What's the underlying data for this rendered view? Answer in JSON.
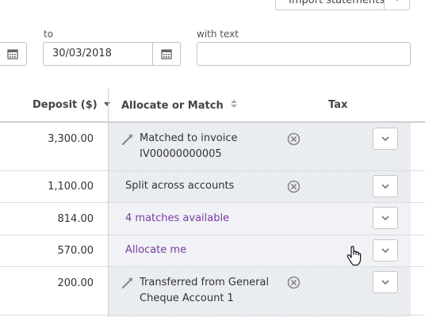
{
  "toolbar": {
    "import_label": "Import statements"
  },
  "filters": {
    "to_label": "to",
    "to_value": "30/03/2018",
    "text_label": "with text",
    "text_value": ""
  },
  "table": {
    "headers": {
      "deposit": "Deposit ($)",
      "allocate": "Allocate or Match",
      "tax": "Tax"
    },
    "rows": [
      {
        "deposit": "3,300.00",
        "line1": "Matched to invoice",
        "line2": "IV00000000005",
        "type": "matched"
      },
      {
        "deposit": "1,100.00",
        "line1": "Split across accounts",
        "line2": "",
        "type": "split"
      },
      {
        "deposit": "814.00",
        "line1": "4 matches available",
        "line2": "",
        "type": "link"
      },
      {
        "deposit": "570.00",
        "line1": "Allocate me",
        "line2": "",
        "type": "link"
      },
      {
        "deposit": "200.00",
        "line1": "Transferred from General",
        "line2": "Cheque Account 1",
        "type": "matched"
      }
    ]
  },
  "colors": {
    "link": "#7b3aa3",
    "row_bg": "#f0f2f5",
    "border": "#c3c3c3"
  }
}
